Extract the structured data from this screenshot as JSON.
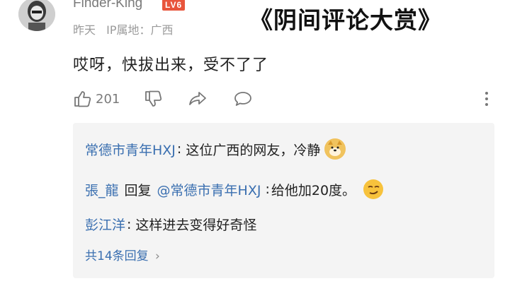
{
  "user": {
    "name": "Finder-King",
    "level_badge": "LV6",
    "time": "昨天",
    "ip_label": "IP属地：",
    "ip_location": "广西"
  },
  "overlay_title": "《阴间评论大赏》",
  "comment": {
    "text": "哎呀，快拔出来，受不了了",
    "like_count": "201"
  },
  "replies": [
    {
      "author": "常德市青年HXJ",
      "separator": ":",
      "text": "这位广西的网友，冷静",
      "emoji": "doge-emoji"
    },
    {
      "author": "張_龍",
      "reply_word": "回复",
      "mention": "@常德市青年HXJ",
      "separator": ":",
      "text": "给他加20度。",
      "emoji": "smirk-emoji"
    },
    {
      "author": "彭江洋",
      "separator": ":",
      "text": "这样进去变得好奇怪"
    }
  ],
  "more_replies": {
    "label": "共14条回复",
    "chevron": "›"
  },
  "colors": {
    "link": "#3a6fb0",
    "badge": "#e8553c",
    "reply_bg": "#f4f4f4",
    "meta": "#9a9a9a"
  },
  "icons": [
    "like-icon",
    "dislike-icon",
    "share-icon",
    "comment-icon",
    "more-icon"
  ]
}
